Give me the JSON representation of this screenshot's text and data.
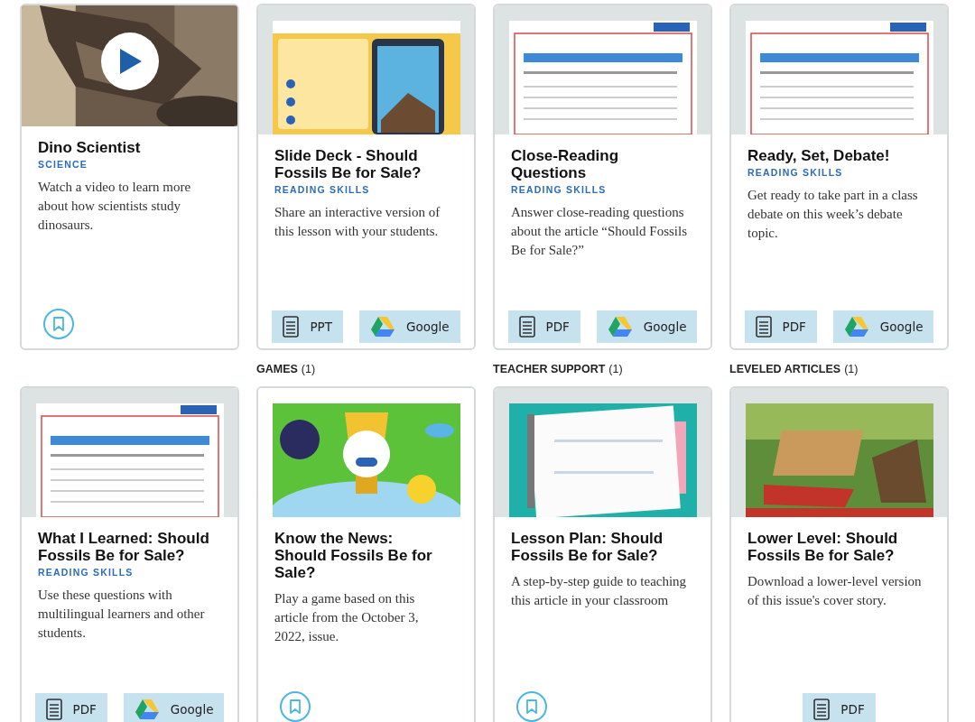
{
  "rows": [
    {
      "cards": [
        {
          "thumbnail": {
            "kind": "video"
          },
          "title": "Dino Scientist",
          "category": "SCIENCE",
          "description": "Watch a video to learn more about how scientists study dinosaurs.",
          "footer": {
            "kind": "bookmark"
          }
        },
        {
          "thumbnail": {
            "kind": "inset"
          },
          "title": "Slide Deck - Should Fossils Be for Sale?",
          "category": "READING SKILLS",
          "description": "Share an interactive version of this lesson with your students.",
          "footer": {
            "kind": "buttons",
            "buttons": [
              {
                "kind": "doc",
                "label": "PPT"
              },
              {
                "kind": "drive",
                "label": "Google"
              }
            ]
          }
        },
        {
          "thumbnail": {
            "kind": "inset"
          },
          "title": "Close-Reading Questions",
          "category": "READING SKILLS",
          "description": "Answer close-reading questions about the article “Should Fossils Be for Sale?”",
          "footer": {
            "kind": "buttons",
            "buttons": [
              {
                "kind": "doc",
                "label": "PDF"
              },
              {
                "kind": "drive",
                "label": "Google"
              }
            ]
          }
        },
        {
          "thumbnail": {
            "kind": "inset"
          },
          "title": "Ready, Set, Debate!",
          "category": "READING SKILLS",
          "description": "Get ready to take part in a class debate on this week’s debate topic.",
          "footer": {
            "kind": "buttons",
            "buttons": [
              {
                "kind": "doc",
                "label": "PDF"
              },
              {
                "kind": "drive",
                "label": "Google"
              }
            ]
          }
        }
      ]
    },
    {
      "cards": [
        {
          "thumbnail": {
            "kind": "inset"
          },
          "title": "What I Learned: Should Fossils Be for Sale?",
          "category": "READING SKILLS",
          "description": "Use these questions with multilingual learners and other students.",
          "footer": {
            "kind": "buttons",
            "buttons": [
              {
                "kind": "doc",
                "label": "PDF"
              },
              {
                "kind": "drive",
                "label": "Google"
              }
            ]
          }
        },
        {
          "section": {
            "label": "GAMES",
            "count": "(1)"
          },
          "thumbnail": {
            "kind": "inset-plain"
          },
          "title": "Know the News: Should Fossils Be for Sale?",
          "description": "Play a game based on this article from the October 3, 2022, issue.",
          "footer": {
            "kind": "bookmark"
          }
        },
        {
          "section": {
            "label": "TEACHER SUPPORT",
            "count": "(1)"
          },
          "thumbnail": {
            "kind": "inset"
          },
          "title": "Lesson Plan: Should Fossils Be for Sale?",
          "description": "A step-by-step guide to teaching this article in your classroom",
          "footer": {
            "kind": "bookmark"
          }
        },
        {
          "section": {
            "label": "LEVELED ARTICLES",
            "count": "(1)"
          },
          "thumbnail": {
            "kind": "inset"
          },
          "title": "Lower Level: Should Fossils Be for Sale?",
          "description": "Download a lower-level version of this issue's cover story.",
          "footer": {
            "kind": "buttons",
            "buttons": [
              {
                "kind": "doc",
                "label": "PDF"
              }
            ]
          }
        }
      ]
    }
  ]
}
